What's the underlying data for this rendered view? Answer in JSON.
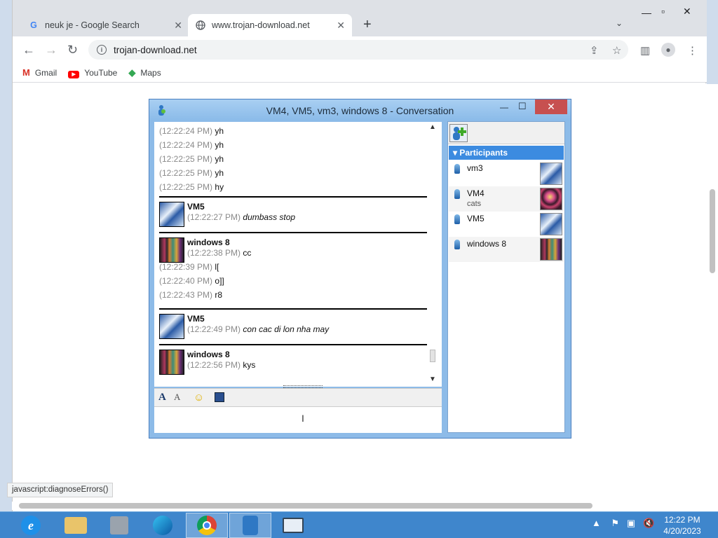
{
  "browser": {
    "tabs": [
      {
        "title": "neuk je - Google Search",
        "favicon": "google-icon"
      },
      {
        "title": "www.trojan-download.net",
        "favicon": "globe-icon"
      }
    ],
    "address": "trojan-download.net",
    "bookmarks": [
      {
        "label": "Gmail",
        "icon": "gmail-icon"
      },
      {
        "label": "YouTube",
        "icon": "youtube-icon"
      },
      {
        "label": "Maps",
        "icon": "maps-icon"
      }
    ],
    "status_text": "javascript:diagnoseErrors()"
  },
  "conversation": {
    "title": "VM4, VM5, vm3, windows 8 - Conversation",
    "messages": [
      {
        "time": "(12:22:24 PM)",
        "text": "yh"
      },
      {
        "time": "(12:22:24 PM)",
        "text": "yh"
      },
      {
        "time": "(12:22:25 PM)",
        "text": "yh"
      },
      {
        "time": "(12:22:25 PM)",
        "text": "yh"
      },
      {
        "time": "(12:22:25 PM)",
        "text": "hy"
      },
      {
        "sender": "VM5",
        "time": "(12:22:27 PM)",
        "text": "dumbass stop"
      },
      {
        "sender": "windows 8",
        "time": "(12:22:38 PM)",
        "text": "cc"
      },
      {
        "time": "(12:22:39 PM)",
        "text": "l["
      },
      {
        "time": "(12:22:40 PM)",
        "text": "o]]"
      },
      {
        "time": "(12:22:43 PM)",
        "text": "r8"
      },
      {
        "sender": "VM5",
        "time": "(12:22:49 PM)",
        "text": "con cac di lon nha may"
      },
      {
        "sender": "windows 8",
        "time": "(12:22:56 PM)",
        "text": "kys"
      }
    ],
    "participants_header": "Participants",
    "participants": [
      {
        "name": "vm3",
        "status": ""
      },
      {
        "name": "VM4",
        "status": "cats"
      },
      {
        "name": "VM5",
        "status": ""
      },
      {
        "name": "windows 8",
        "status": ""
      }
    ]
  },
  "taskbar": {
    "time": "12:22 PM",
    "date": "4/20/2023"
  }
}
